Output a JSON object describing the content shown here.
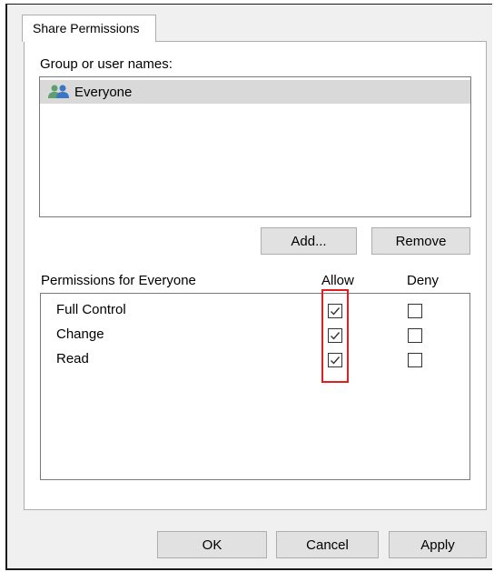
{
  "tab": {
    "label": "Share Permissions"
  },
  "group_section": {
    "label": "Group or user names:",
    "users": [
      {
        "name": "Everyone",
        "icon": "users-group-icon"
      }
    ],
    "add_button": "Add...",
    "remove_button": "Remove"
  },
  "permissions_section": {
    "label": "Permissions for Everyone",
    "allow_header": "Allow",
    "deny_header": "Deny",
    "rows": [
      {
        "name": "Full Control",
        "allow": true,
        "deny": false
      },
      {
        "name": "Change",
        "allow": true,
        "deny": false
      },
      {
        "name": "Read",
        "allow": true,
        "deny": false
      }
    ]
  },
  "footer": {
    "ok": "OK",
    "cancel": "Cancel",
    "apply": "Apply"
  },
  "colors": {
    "highlight": "#e02020",
    "selection": "#d9d9d9",
    "button_bg": "#e1e1e1"
  }
}
